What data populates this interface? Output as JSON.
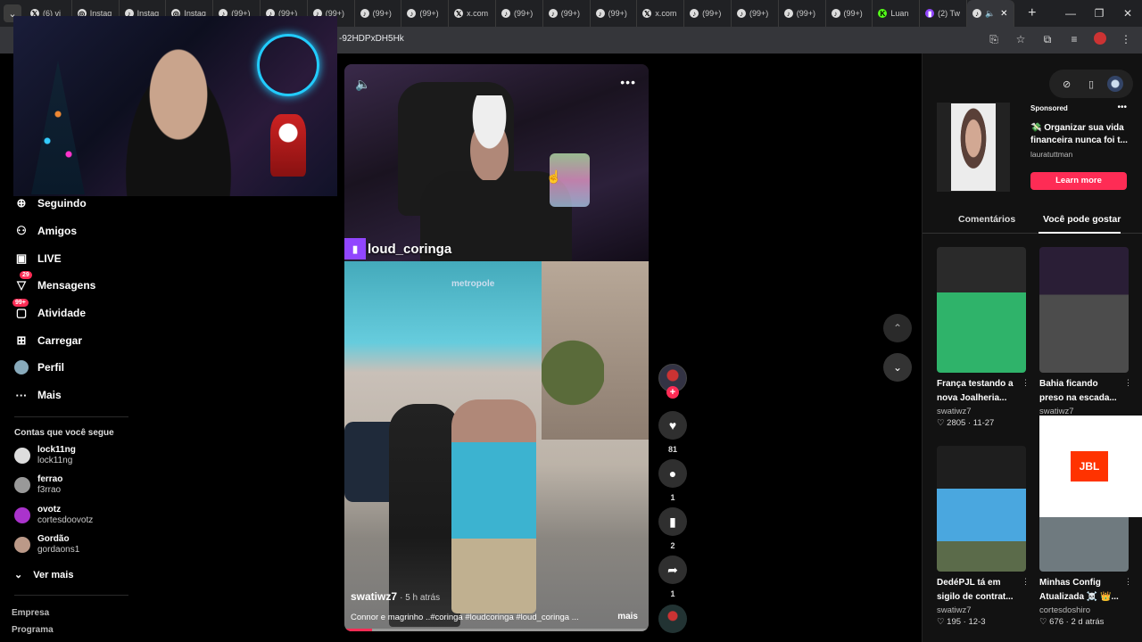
{
  "browser": {
    "tabs": [
      {
        "label": "(6) vi",
        "icon": "x-icon"
      },
      {
        "label": "Instag",
        "icon": "instagram-icon"
      },
      {
        "label": "Instag",
        "icon": "tiktok-icon"
      },
      {
        "label": "Instag",
        "icon": "instagram-icon"
      },
      {
        "label": "(99+)",
        "icon": "tiktok-icon"
      },
      {
        "label": "(99+)",
        "icon": "tiktok-icon"
      },
      {
        "label": "(99+)",
        "icon": "tiktok-icon"
      },
      {
        "label": "(99+)",
        "icon": "tiktok-icon"
      },
      {
        "label": "(99+)",
        "icon": "tiktok-icon"
      },
      {
        "label": "x.com",
        "icon": "x-icon"
      },
      {
        "label": "(99+)",
        "icon": "tiktok-icon"
      },
      {
        "label": "(99+)",
        "icon": "tiktok-icon"
      },
      {
        "label": "(99+)",
        "icon": "tiktok-icon"
      },
      {
        "label": "x.com",
        "icon": "x-icon"
      },
      {
        "label": "(99+)",
        "icon": "tiktok-icon"
      },
      {
        "label": "(99+)",
        "icon": "tiktok-icon"
      },
      {
        "label": "(99+)",
        "icon": "tiktok-icon"
      },
      {
        "label": "(99+)",
        "icon": "tiktok-icon"
      },
      {
        "label": "Luan",
        "icon": "kick-icon"
      },
      {
        "label": "(2) Tw",
        "icon": "twitch-icon"
      }
    ],
    "url_fragment": "-92HDPxDH5Hk"
  },
  "leftnav": {
    "items": [
      {
        "label": "Seguindo",
        "icon": "following-icon"
      },
      {
        "label": "Amigos",
        "icon": "friends-icon"
      },
      {
        "label": "LIVE",
        "icon": "live-icon"
      },
      {
        "label": "Mensagens",
        "icon": "messages-icon",
        "badge": "29"
      },
      {
        "label": "Atividade",
        "icon": "activity-icon",
        "badge": "99+"
      },
      {
        "label": "Carregar",
        "icon": "upload-icon"
      },
      {
        "label": "Perfil",
        "icon": "profile-icon"
      },
      {
        "label": "Mais",
        "icon": "more-icon"
      }
    ],
    "following_title": "Contas que você segue",
    "following": [
      {
        "name": "lock11ng",
        "handle": "lock11ng"
      },
      {
        "name": "ferrao",
        "handle": "f3rrao"
      },
      {
        "name": "ovotz",
        "handle": "cortesdoovotz"
      },
      {
        "name": "Gordão",
        "handle": "gordaons1"
      }
    ],
    "see_more": "Ver mais",
    "footer": [
      "Empresa",
      "Programa"
    ]
  },
  "video": {
    "streamer_tag": "loud_coringa",
    "game_logo": "metropole",
    "author": "swatiwz7",
    "time": "· 5 h atrás",
    "caption": "Connor e magrinho ..#coringa #loudcoringa #loud_coringa ...",
    "more": "mais",
    "progress": 0.09
  },
  "actions": {
    "likes": "81",
    "comments": "1",
    "saves": "2",
    "shares": "1"
  },
  "rightpanel": {
    "ad": {
      "sponsored": "Sponsored",
      "title": "💸 Organizar sua vida financeira nunca foi t...",
      "user": "lauratuttman",
      "cta": "Learn more"
    },
    "tabs": [
      "Comentários",
      "Você pode gostar"
    ],
    "cards": [
      {
        "title": "França testando a nova Joalheria...",
        "author": "swatiwz7",
        "likes": "2805",
        "date": "11-27"
      },
      {
        "title": "Bahia ficando preso na escada...",
        "author": "swatiwz7",
        "likes": "",
        "date": ""
      },
      {
        "title": "DedéPJL tá em sigilo de contrat...",
        "author": "swatiwz7",
        "likes": "195",
        "date": "12-3"
      },
      {
        "title": "Minhas Config Atualizada ☠️ 👑...",
        "author": "cortesdoshiro",
        "likes": "676",
        "date": "2 d atrás"
      }
    ],
    "popup_logo": "JBL"
  }
}
